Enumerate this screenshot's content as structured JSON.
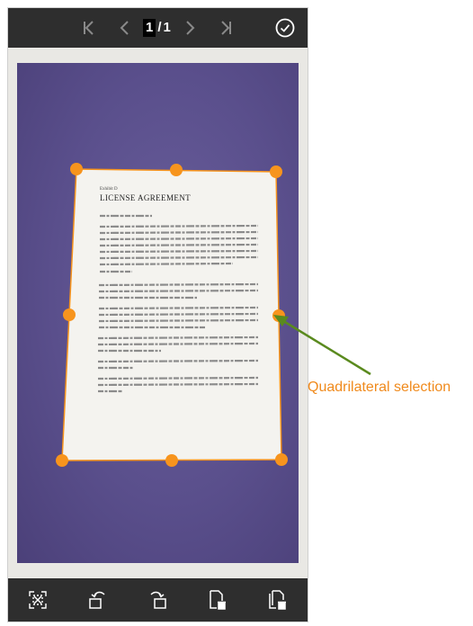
{
  "topbar": {
    "first_page_icon": "first-page-icon",
    "prev_page_icon": "prev-page-icon",
    "page_current": "1",
    "page_separator": "/",
    "page_total": "1",
    "next_page_icon": "next-page-icon",
    "last_page_icon": "last-page-icon",
    "confirm_icon": "check-circle-icon"
  },
  "document": {
    "heading_small": "Exhibit D",
    "title": "LICENSE AGREEMENT"
  },
  "annotation": {
    "label": "Quadrilateral selection"
  },
  "toolbar": {
    "items": [
      {
        "icon": "select-all-corners-icon"
      },
      {
        "icon": "rotate-left-icon"
      },
      {
        "icon": "rotate-right-icon"
      },
      {
        "icon": "delete-page-icon"
      },
      {
        "icon": "delete-all-pages-icon"
      }
    ]
  },
  "colors": {
    "bar_bg": "#2e2e2e",
    "handle": "#f7941d",
    "photo_bg": "#5a4f8c",
    "annotation_text": "#f08a1c",
    "arrow": "#5a8a1e"
  }
}
